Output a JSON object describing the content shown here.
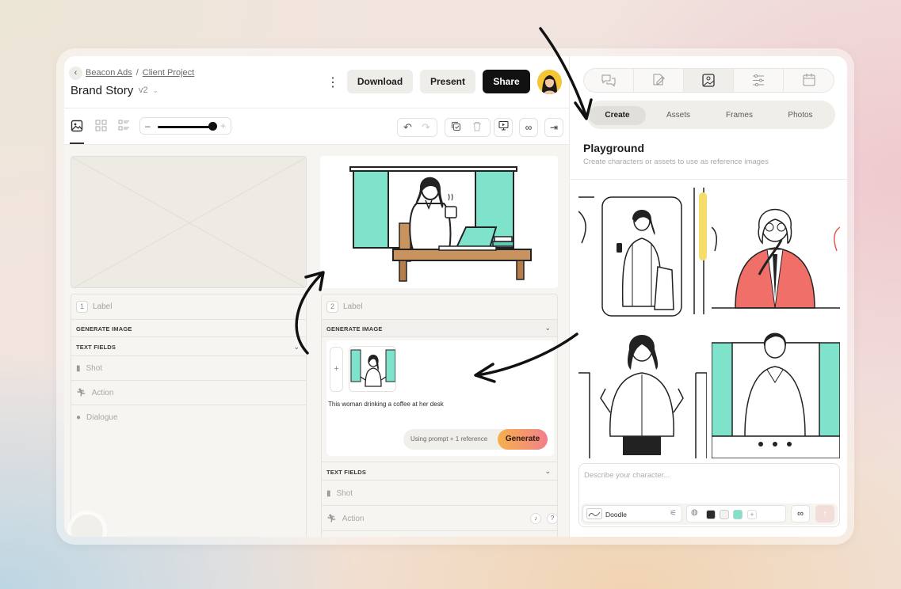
{
  "breadcrumb": {
    "back_icon": "chevron-left-icon",
    "workspace": "Beacon Ads",
    "separator": "/",
    "project": "Client Project"
  },
  "doc": {
    "title": "Brand Story",
    "version": "v2"
  },
  "header": {
    "download": "Download",
    "present": "Present",
    "share": "Share"
  },
  "cards": [
    {
      "number": "1",
      "label": "Label",
      "generate_section": "GENERATE IMAGE",
      "text_fields_section": "TEXT FIELDS",
      "fields": [
        "Shot",
        "Action",
        "Dialogue"
      ]
    },
    {
      "number": "2",
      "label": "Label",
      "generate_section": "GENERATE IMAGE",
      "prompt": "This woman drinking a coffee at her desk",
      "using": "Using prompt + 1 reference",
      "generate": "Generate",
      "text_fields_section": "TEXT FIELDS",
      "fields": [
        "Shot",
        "Action"
      ]
    }
  ],
  "right": {
    "tabs": [
      "Create",
      "Assets",
      "Frames",
      "Photos"
    ],
    "active_tab": "Create",
    "title": "Playground",
    "subtitle": "Create characters or assets to use as reference images",
    "input_placeholder": "Describe your character...",
    "style": "Doodle",
    "palette": [
      "#2b2b2b",
      "#f3f2ee",
      "#7fe3cc"
    ]
  },
  "colors": {
    "accent_mint": "#7fe3cc",
    "coat_red": "#f07069",
    "generate_from": "#f7b04b",
    "generate_to": "#f1808b"
  }
}
